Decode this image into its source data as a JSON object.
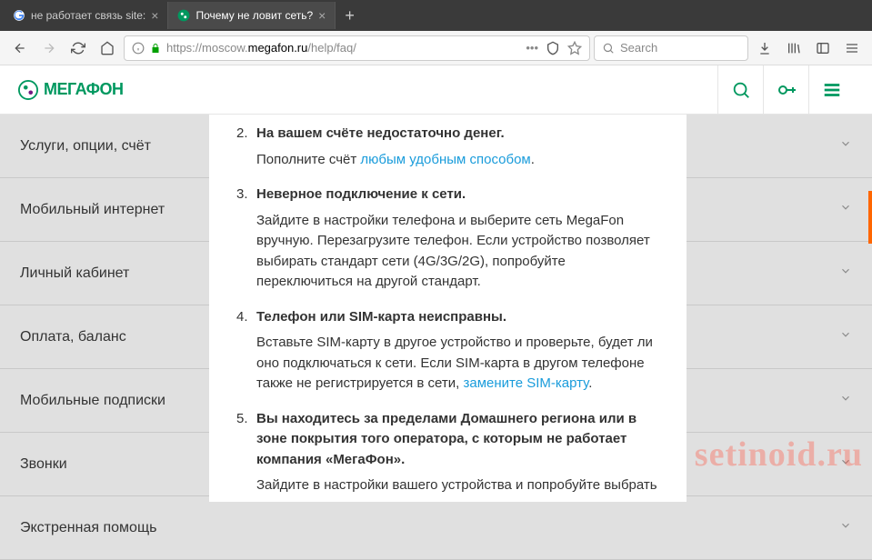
{
  "browser": {
    "tabs": [
      {
        "title": "не работает связь site:",
        "active": false
      },
      {
        "title": "Почему не ловит сеть?",
        "active": true
      }
    ],
    "url": {
      "protocol": "https://",
      "host_pre": "moscow.",
      "domain": "megafon.ru",
      "path": "/help/faq/"
    },
    "search_placeholder": "Search"
  },
  "site": {
    "brand": "МегаФон"
  },
  "sidebar": {
    "items": [
      "Услуги, опции, счёт",
      "Мобильный интернет",
      "Личный кабинет",
      "Оплата, баланс",
      "Мобильные подписки",
      "Звонки",
      "Экстренная помощь"
    ]
  },
  "faq": {
    "items": [
      {
        "n": "2.",
        "heading": "На вашем счёте недостаточно денег.",
        "body_pre": "Пополните счёт ",
        "link": "любым удобным способом",
        "body_post": "."
      },
      {
        "n": "3.",
        "heading": "Неверное подключение к сети.",
        "body": "Зайдите в настройки телефона и выберите сеть MegaFon вручную. Перезагрузите телефон. Если устройство позволяет выбирать стандарт сети (4G/3G/2G), попробуйте переключиться на другой стандарт."
      },
      {
        "n": "4.",
        "heading": "Телефон или SIM-карта неисправны.",
        "body_pre": "Вставьте SIM-карту в другое устройство и проверьте, будет ли оно подключаться к сети. Если SIM-карта в другом телефоне также не регистрируется в сети, ",
        "link": "замените SIM-карту",
        "body_post": "."
      },
      {
        "n": "5.",
        "heading": "Вы находитесь за пределами Домашнего региона или в зоне покрытия того оператора, с которым не работает компания «МегаФон».",
        "body": "Зайдите в настройки вашего устройства и попробуйте выбрать вручную другую сеть."
      }
    ]
  },
  "watermark": "setinoid.ru"
}
